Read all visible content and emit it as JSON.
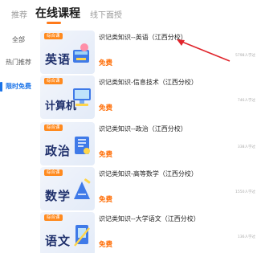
{
  "tabs": [
    {
      "label": "推荐",
      "active": false
    },
    {
      "label": "在线课程",
      "active": true
    },
    {
      "label": "线下面授",
      "active": false
    }
  ],
  "sidebar": {
    "items": [
      {
        "label": "全部",
        "active": false
      },
      {
        "label": "热门推荐",
        "active": false
      },
      {
        "label": "限时免费",
        "active": true
      }
    ]
  },
  "courses": [
    {
      "tag": "综合课",
      "word": "英语",
      "title": "识记类知识--英语（江西分校）",
      "price": "免费",
      "count": "5798人学过",
      "icon": "english-book-icon",
      "bg": "#eef3fb"
    },
    {
      "tag": "综合课",
      "word": "计算机",
      "title": "识记类知识-信息技术（江西分校）",
      "price": "免费",
      "count": "746人学过",
      "icon": "computer-icon",
      "bg": "#eef3fb"
    },
    {
      "tag": "综合课",
      "word": "政治",
      "title": "识记类知识--政治（江西分校）",
      "price": "免费",
      "count": "338人学过",
      "icon": "politics-icon",
      "bg": "#eef3fb"
    },
    {
      "tag": "综合课",
      "word": "数学",
      "title": "识记类知识-高等数学（江西分校）",
      "price": "免费",
      "count": "1550人学过",
      "icon": "math-icon",
      "bg": "#eef3fb"
    },
    {
      "tag": "综合课",
      "word": "语文",
      "title": "识记类知识--大学语文（江西分校）",
      "price": "免费",
      "count": "136人学过",
      "icon": "chinese-icon",
      "bg": "#eef3fb"
    }
  ],
  "colors": {
    "accent": "#ff7a1a",
    "price": "#ff6a00",
    "sidebar_active": "#1a73e8",
    "arrow": "#e0242b"
  }
}
